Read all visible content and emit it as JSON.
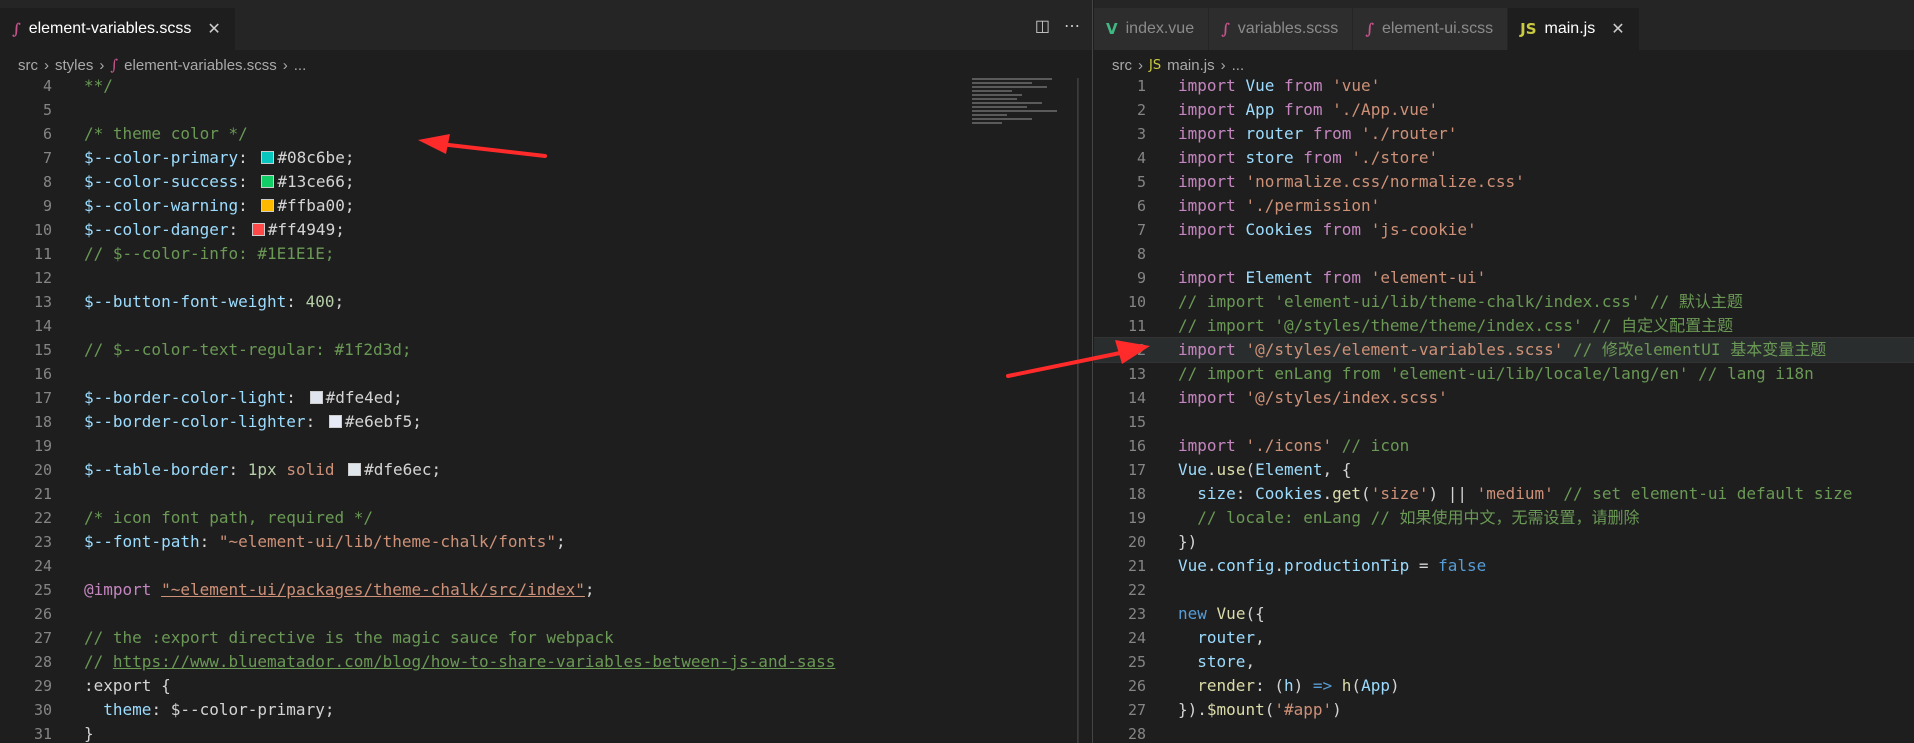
{
  "left": {
    "tabs": [
      {
        "label": "element-variables.scss",
        "icon": "sass-file-icon",
        "active": true
      }
    ],
    "breadcrumb": [
      "src",
      "styles",
      "element-variables.scss",
      "..."
    ],
    "lines": [
      {
        "n": "4",
        "parts": [
          [
            "cmt",
            "**/"
          ]
        ]
      },
      {
        "n": "5",
        "parts": []
      },
      {
        "n": "6",
        "parts": [
          [
            "cmt",
            "/* theme color */"
          ]
        ]
      },
      {
        "n": "7",
        "parts": [
          [
            "var",
            "$--color-primary"
          ],
          [
            "plain",
            ": "
          ],
          [
            "swatch",
            "#08c6be"
          ],
          [
            "plain",
            "#08c6be;"
          ]
        ]
      },
      {
        "n": "8",
        "parts": [
          [
            "var",
            "$--color-success"
          ],
          [
            "plain",
            ": "
          ],
          [
            "swatch",
            "#13ce66"
          ],
          [
            "plain",
            "#13ce66;"
          ]
        ]
      },
      {
        "n": "9",
        "parts": [
          [
            "var",
            "$--color-warning"
          ],
          [
            "plain",
            ": "
          ],
          [
            "swatch",
            "#ffba00"
          ],
          [
            "plain",
            "#ffba00;"
          ]
        ]
      },
      {
        "n": "10",
        "parts": [
          [
            "var",
            "$--color-danger"
          ],
          [
            "plain",
            ": "
          ],
          [
            "swatch",
            "#ff4949"
          ],
          [
            "plain",
            "#ff4949;"
          ]
        ]
      },
      {
        "n": "11",
        "parts": [
          [
            "cmt",
            "// $--color-info: #1E1E1E;"
          ]
        ]
      },
      {
        "n": "12",
        "parts": []
      },
      {
        "n": "13",
        "parts": [
          [
            "var",
            "$--button-font-weight"
          ],
          [
            "plain",
            ": "
          ],
          [
            "num",
            "400"
          ],
          [
            "plain",
            ";"
          ]
        ]
      },
      {
        "n": "14",
        "parts": []
      },
      {
        "n": "15",
        "parts": [
          [
            "cmt",
            "// $--color-text-regular: #1f2d3d;"
          ]
        ]
      },
      {
        "n": "16",
        "parts": []
      },
      {
        "n": "17",
        "parts": [
          [
            "var",
            "$--border-color-light"
          ],
          [
            "plain",
            ": "
          ],
          [
            "swatch",
            "#dfe4ed"
          ],
          [
            "plain",
            "#dfe4ed;"
          ]
        ]
      },
      {
        "n": "18",
        "parts": [
          [
            "var",
            "$--border-color-lighter"
          ],
          [
            "plain",
            ": "
          ],
          [
            "swatch",
            "#e6ebf5"
          ],
          [
            "plain",
            "#e6ebf5;"
          ]
        ]
      },
      {
        "n": "19",
        "parts": []
      },
      {
        "n": "20",
        "parts": [
          [
            "var",
            "$--table-border"
          ],
          [
            "plain",
            ": "
          ],
          [
            "num",
            "1px"
          ],
          [
            "plain",
            " "
          ],
          [
            "str",
            "solid"
          ],
          [
            "plain",
            " "
          ],
          [
            "swatch",
            "#dfe6ec"
          ],
          [
            "plain",
            "#dfe6ec;"
          ]
        ]
      },
      {
        "n": "21",
        "parts": []
      },
      {
        "n": "22",
        "parts": [
          [
            "cmt",
            "/* icon font path, required */"
          ]
        ]
      },
      {
        "n": "23",
        "parts": [
          [
            "var",
            "$--font-path"
          ],
          [
            "plain",
            ": "
          ],
          [
            "str",
            "\"~element-ui/lib/theme-chalk/fonts\""
          ],
          [
            "plain",
            ";"
          ]
        ]
      },
      {
        "n": "24",
        "parts": []
      },
      {
        "n": "25",
        "parts": [
          [
            "kw2",
            "@import"
          ],
          [
            "plain",
            " "
          ],
          [
            "strlink",
            "\"~element-ui/packages/theme-chalk/src/index\""
          ],
          [
            "plain",
            ";"
          ]
        ]
      },
      {
        "n": "26",
        "parts": []
      },
      {
        "n": "27",
        "parts": [
          [
            "cmt",
            "// the :export directive is the magic sauce for webpack"
          ]
        ]
      },
      {
        "n": "28",
        "parts": [
          [
            "cmt",
            "// "
          ],
          [
            "link",
            "https://www.bluematador.com/blog/how-to-share-variables-between-js-and-sass"
          ]
        ]
      },
      {
        "n": "29",
        "parts": [
          [
            "plain",
            ":export {"
          ]
        ]
      },
      {
        "n": "30",
        "parts": [
          [
            "plain",
            "  "
          ],
          [
            "var",
            "theme"
          ],
          [
            "plain",
            ": $--color-primary;"
          ]
        ]
      },
      {
        "n": "31",
        "parts": [
          [
            "plain",
            "}"
          ]
        ]
      }
    ]
  },
  "right": {
    "tabs": [
      {
        "label": "index.vue",
        "icon": "vue-file-icon",
        "active": false
      },
      {
        "label": "variables.scss",
        "icon": "sass-file-icon",
        "active": false
      },
      {
        "label": "element-ui.scss",
        "icon": "sass-file-icon",
        "active": false
      },
      {
        "label": "main.js",
        "icon": "js-file-icon",
        "active": true
      }
    ],
    "breadcrumb": [
      "src",
      "main.js",
      "..."
    ],
    "lines": [
      {
        "n": "1",
        "parts": [
          [
            "kw2",
            "import"
          ],
          [
            "plain",
            " "
          ],
          [
            "var",
            "Vue"
          ],
          [
            "plain",
            " "
          ],
          [
            "kw2",
            "from"
          ],
          [
            "plain",
            " "
          ],
          [
            "str",
            "'vue'"
          ]
        ]
      },
      {
        "n": "2",
        "parts": [
          [
            "kw2",
            "import"
          ],
          [
            "plain",
            " "
          ],
          [
            "var",
            "App"
          ],
          [
            "plain",
            " "
          ],
          [
            "kw2",
            "from"
          ],
          [
            "plain",
            " "
          ],
          [
            "str",
            "'./App.vue'"
          ]
        ]
      },
      {
        "n": "3",
        "parts": [
          [
            "kw2",
            "import"
          ],
          [
            "plain",
            " "
          ],
          [
            "var",
            "router"
          ],
          [
            "plain",
            " "
          ],
          [
            "kw2",
            "from"
          ],
          [
            "plain",
            " "
          ],
          [
            "str",
            "'./router'"
          ]
        ]
      },
      {
        "n": "4",
        "parts": [
          [
            "kw2",
            "import"
          ],
          [
            "plain",
            " "
          ],
          [
            "var",
            "store"
          ],
          [
            "plain",
            " "
          ],
          [
            "kw2",
            "from"
          ],
          [
            "plain",
            " "
          ],
          [
            "str",
            "'./store'"
          ]
        ]
      },
      {
        "n": "5",
        "parts": [
          [
            "kw2",
            "import"
          ],
          [
            "plain",
            " "
          ],
          [
            "str",
            "'normalize.css/normalize.css'"
          ]
        ]
      },
      {
        "n": "6",
        "parts": [
          [
            "kw2",
            "import"
          ],
          [
            "plain",
            " "
          ],
          [
            "str",
            "'./permission'"
          ]
        ]
      },
      {
        "n": "7",
        "parts": [
          [
            "kw2",
            "import"
          ],
          [
            "plain",
            " "
          ],
          [
            "var",
            "Cookies"
          ],
          [
            "plain",
            " "
          ],
          [
            "kw2",
            "from"
          ],
          [
            "plain",
            " "
          ],
          [
            "str",
            "'js-cookie'"
          ]
        ]
      },
      {
        "n": "8",
        "parts": []
      },
      {
        "n": "9",
        "parts": [
          [
            "kw2",
            "import"
          ],
          [
            "plain",
            " "
          ],
          [
            "var",
            "Element"
          ],
          [
            "plain",
            " "
          ],
          [
            "kw2",
            "from"
          ],
          [
            "plain",
            " "
          ],
          [
            "str",
            "'element-ui'"
          ]
        ]
      },
      {
        "n": "10",
        "parts": [
          [
            "cmt",
            "// import 'element-ui/lib/theme-chalk/index.css' // 默认主题"
          ]
        ]
      },
      {
        "n": "11",
        "parts": [
          [
            "cmt",
            "// import '@/styles/theme/theme/index.css' // 自定义配置主题"
          ]
        ]
      },
      {
        "n": "12",
        "highlight": true,
        "parts": [
          [
            "kw2",
            "import"
          ],
          [
            "plain",
            " "
          ],
          [
            "str",
            "'@/styles/element-variables.scss'"
          ],
          [
            "plain",
            " "
          ],
          [
            "cmt",
            "// 修改elementUI 基本变量主题"
          ]
        ]
      },
      {
        "n": "13",
        "parts": [
          [
            "cmt",
            "// import enLang from 'element-ui/lib/locale/lang/en' // lang i18n"
          ]
        ]
      },
      {
        "n": "14",
        "parts": [
          [
            "kw2",
            "import"
          ],
          [
            "plain",
            " "
          ],
          [
            "str",
            "'@/styles/index.scss'"
          ]
        ]
      },
      {
        "n": "15",
        "parts": []
      },
      {
        "n": "16",
        "parts": [
          [
            "kw2",
            "import"
          ],
          [
            "plain",
            " "
          ],
          [
            "str",
            "'./icons'"
          ],
          [
            "plain",
            " "
          ],
          [
            "cmt",
            "// icon"
          ]
        ]
      },
      {
        "n": "17",
        "parts": [
          [
            "var",
            "Vue"
          ],
          [
            "plain",
            "."
          ],
          [
            "fn",
            "use"
          ],
          [
            "plain",
            "("
          ],
          [
            "var",
            "Element"
          ],
          [
            "plain",
            ", {"
          ]
        ]
      },
      {
        "n": "18",
        "parts": [
          [
            "plain",
            "  "
          ],
          [
            "var",
            "size"
          ],
          [
            "plain",
            ": "
          ],
          [
            "var",
            "Cookies"
          ],
          [
            "plain",
            "."
          ],
          [
            "fn",
            "get"
          ],
          [
            "plain",
            "("
          ],
          [
            "str",
            "'size'"
          ],
          [
            "plain",
            ") || "
          ],
          [
            "str",
            "'medium'"
          ],
          [
            "plain",
            " "
          ],
          [
            "cmt",
            "// set element-ui default size"
          ]
        ]
      },
      {
        "n": "19",
        "parts": [
          [
            "plain",
            "  "
          ],
          [
            "cmt",
            "// locale: enLang // 如果使用中文，无需设置，请删除"
          ]
        ]
      },
      {
        "n": "20",
        "parts": [
          [
            "plain",
            "})"
          ]
        ]
      },
      {
        "n": "21",
        "parts": [
          [
            "var",
            "Vue"
          ],
          [
            "plain",
            "."
          ],
          [
            "var",
            "config"
          ],
          [
            "plain",
            "."
          ],
          [
            "var",
            "productionTip"
          ],
          [
            "plain",
            " = "
          ],
          [
            "kw",
            "false"
          ]
        ]
      },
      {
        "n": "22",
        "parts": []
      },
      {
        "n": "23",
        "parts": [
          [
            "kw",
            "new"
          ],
          [
            "plain",
            " "
          ],
          [
            "fn",
            "Vue"
          ],
          [
            "plain",
            "({"
          ]
        ]
      },
      {
        "n": "24",
        "parts": [
          [
            "plain",
            "  "
          ],
          [
            "var",
            "router"
          ],
          [
            "plain",
            ","
          ]
        ]
      },
      {
        "n": "25",
        "parts": [
          [
            "plain",
            "  "
          ],
          [
            "var",
            "store"
          ],
          [
            "plain",
            ","
          ]
        ]
      },
      {
        "n": "26",
        "parts": [
          [
            "plain",
            "  "
          ],
          [
            "fn",
            "render"
          ],
          [
            "plain",
            ": ("
          ],
          [
            "var",
            "h"
          ],
          [
            "plain",
            ") "
          ],
          [
            "kw",
            "=>"
          ],
          [
            "plain",
            " "
          ],
          [
            "fn",
            "h"
          ],
          [
            "plain",
            "("
          ],
          [
            "var",
            "App"
          ],
          [
            "plain",
            ")"
          ]
        ]
      },
      {
        "n": "27",
        "parts": [
          [
            "plain",
            "})."
          ],
          [
            "fn",
            "$mount"
          ],
          [
            "plain",
            "("
          ],
          [
            "str",
            "'#app'"
          ],
          [
            "plain",
            ")"
          ]
        ]
      },
      {
        "n": "28",
        "parts": []
      }
    ]
  },
  "colors": {
    "annotation_arrow": "#ff2a2a",
    "editor_bg": "#1e1e1e",
    "tabbar_bg": "#252526"
  }
}
